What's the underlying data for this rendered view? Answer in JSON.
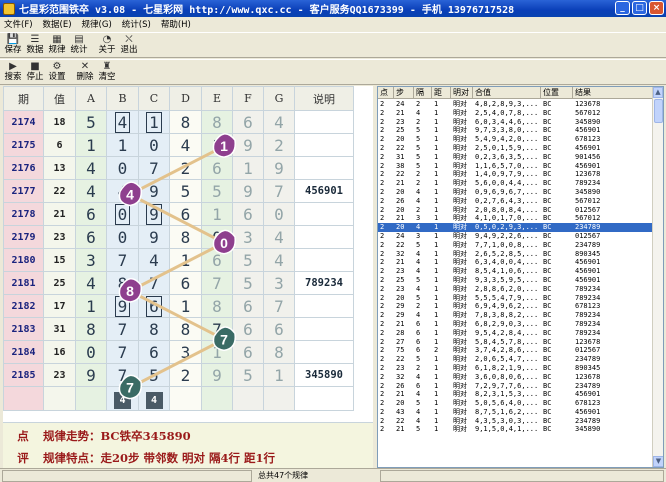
{
  "window": {
    "title": "七星彩范围铁卒 v3.08 - 七星彩网 http://www.qxc.cc - 客户服务QQ1673399 - 手机 13976717528"
  },
  "menu": [
    "文件(F)",
    "数据(E)",
    "规律(G)",
    "统计(S)",
    "帮助(H)"
  ],
  "toolbar1": [
    {
      "label": "保存",
      "icon": "save-icon",
      "glyph": "💾"
    },
    {
      "label": "数据",
      "icon": "data-icon",
      "glyph": "☰"
    },
    {
      "label": "规律",
      "icon": "rule-icon",
      "glyph": "▦"
    },
    {
      "label": "统计",
      "icon": "stats-icon",
      "glyph": "▤"
    },
    {
      "label": "关于",
      "icon": "about-icon",
      "glyph": "◔"
    },
    {
      "label": "退出",
      "icon": "exit-icon",
      "glyph": "⛌"
    }
  ],
  "toolbar2": [
    {
      "label": "搜索",
      "icon": "play-icon",
      "glyph": "▶"
    },
    {
      "label": "停止",
      "icon": "stop-icon",
      "glyph": "■"
    },
    {
      "label": "设置",
      "icon": "settings-icon",
      "glyph": "⚙"
    },
    {
      "label": "删除",
      "icon": "delete-icon",
      "glyph": "✕"
    },
    {
      "label": "清空",
      "icon": "clear-icon",
      "glyph": "♜"
    }
  ],
  "grid": {
    "headers": [
      "期",
      "值",
      "A",
      "B",
      "C",
      "D",
      "E",
      "F",
      "G",
      "说明"
    ],
    "rows": [
      {
        "qi": "2174",
        "zhi": "18",
        "digits": [
          "5",
          "4",
          "1",
          "8",
          "8",
          "6",
          "4"
        ],
        "note": ""
      },
      {
        "qi": "2175",
        "zhi": "6",
        "digits": [
          "1",
          "1",
          "0",
          "4",
          "1",
          "9",
          "2"
        ],
        "note": ""
      },
      {
        "qi": "2176",
        "zhi": "13",
        "digits": [
          "4",
          "0",
          "7",
          "2",
          "6",
          "1",
          "9"
        ],
        "note": ""
      },
      {
        "qi": "2177",
        "zhi": "22",
        "digits": [
          "4",
          "4",
          "9",
          "5",
          "5",
          "9",
          "7"
        ],
        "note": "456901"
      },
      {
        "qi": "2178",
        "zhi": "21",
        "digits": [
          "6",
          "0",
          "9",
          "6",
          "1",
          "6",
          "0"
        ],
        "note": ""
      },
      {
        "qi": "2179",
        "zhi": "23",
        "digits": [
          "6",
          "0",
          "9",
          "8",
          "0",
          "3",
          "4"
        ],
        "note": ""
      },
      {
        "qi": "2180",
        "zhi": "15",
        "digits": [
          "3",
          "7",
          "4",
          "1",
          "6",
          "5",
          "4"
        ],
        "note": ""
      },
      {
        "qi": "2181",
        "zhi": "25",
        "digits": [
          "4",
          "8",
          "7",
          "6",
          "7",
          "5",
          "3"
        ],
        "note": "789234"
      },
      {
        "qi": "2182",
        "zhi": "17",
        "digits": [
          "1",
          "9",
          "6",
          "1",
          "8",
          "6",
          "7"
        ],
        "note": ""
      },
      {
        "qi": "2183",
        "zhi": "31",
        "digits": [
          "8",
          "7",
          "8",
          "8",
          "7",
          "6",
          "6"
        ],
        "note": ""
      },
      {
        "qi": "2184",
        "zhi": "16",
        "digits": [
          "0",
          "7",
          "6",
          "3",
          "1",
          "6",
          "8"
        ],
        "note": ""
      },
      {
        "qi": "2185",
        "zhi": "23",
        "digits": [
          "9",
          "7",
          "5",
          "2",
          "9",
          "5",
          "1"
        ],
        "note": "345890"
      },
      {
        "qi": "",
        "zhi": "",
        "digits": [
          "",
          "4",
          "4",
          "",
          "",
          "",
          ""
        ],
        "note": ""
      }
    ]
  },
  "summary": {
    "k1": "点",
    "line1": "规律走势：BC铁卒345890",
    "k2": "评",
    "line2": "规律特点：走20步  带邻数  明对    隔4行  距1行"
  },
  "list": {
    "headers": [
      "点",
      "步",
      "隔",
      "距",
      "明对",
      "合值",
      "位置",
      "结果"
    ],
    "selected_index": 14,
    "rows": [
      [
        "2",
        "24",
        "2",
        "1",
        "明对",
        "4,8,2,8,9,3,...",
        "BC",
        "123678"
      ],
      [
        "2",
        "21",
        "4",
        "1",
        "明对",
        "2,5,4,0,7,8,...",
        "BC",
        "567012"
      ],
      [
        "2",
        "23",
        "2",
        "1",
        "明对",
        "6,0,3,4,4,6,...",
        "BC",
        "345890"
      ],
      [
        "2",
        "25",
        "5",
        "1",
        "明对",
        "9,7,3,3,8,0,...",
        "BC",
        "456901"
      ],
      [
        "2",
        "20",
        "5",
        "1",
        "明对",
        "5,4,9,4,2,0,...",
        "BC",
        "678123"
      ],
      [
        "2",
        "22",
        "5",
        "1",
        "明对",
        "2,5,0,1,5,9,...",
        "BC",
        "456901"
      ],
      [
        "2",
        "31",
        "5",
        "1",
        "明对",
        "0,2,3,6,3,5,...",
        "BC",
        "901456"
      ],
      [
        "2",
        "38",
        "5",
        "1",
        "明对",
        "1,1,6,5,7,0,...",
        "BC",
        "456901"
      ],
      [
        "2",
        "22",
        "2",
        "1",
        "明对",
        "1,4,0,9,7,9,...",
        "BC",
        "123678"
      ],
      [
        "2",
        "21",
        "2",
        "1",
        "明对",
        "5,6,0,0,4,4,...",
        "BC",
        "789234"
      ],
      [
        "2",
        "20",
        "4",
        "1",
        "明对",
        "0,9,6,9,6,7,...",
        "BC",
        "345890"
      ],
      [
        "2",
        "26",
        "4",
        "1",
        "明对",
        "0,2,7,6,4,3,...",
        "BC",
        "567012"
      ],
      [
        "2",
        "20",
        "2",
        "1",
        "明对",
        "2,0,8,0,8,4,...",
        "BC",
        "012567"
      ],
      [
        "2",
        "21",
        "3",
        "1",
        "明对",
        "4,1,0,1,7,0,...",
        "BC",
        "567012"
      ],
      [
        "2",
        "20",
        "4",
        "1",
        "明对",
        "0,5,0,2,9,3,...",
        "BC",
        "234789"
      ],
      [
        "2",
        "24",
        "3",
        "1",
        "明对",
        "9,4,9,2,2,6,...",
        "BC",
        "012567"
      ],
      [
        "2",
        "22",
        "5",
        "1",
        "明对",
        "7,7,1,0,0,8,...",
        "BC",
        "234789"
      ],
      [
        "2",
        "32",
        "4",
        "1",
        "明对",
        "2,6,5,2,8,5,...",
        "BC",
        "890345"
      ],
      [
        "2",
        "21",
        "4",
        "1",
        "明对",
        "6,3,4,0,0,4,...",
        "BC",
        "456901"
      ],
      [
        "2",
        "23",
        "4",
        "1",
        "明对",
        "8,5,4,1,0,6,...",
        "BC",
        "456901"
      ],
      [
        "2",
        "25",
        "5",
        "1",
        "明对",
        "9,3,3,5,9,5,...",
        "BC",
        "456901"
      ],
      [
        "2",
        "23",
        "4",
        "1",
        "明对",
        "2,8,8,6,2,0,...",
        "BC",
        "789234"
      ],
      [
        "2",
        "20",
        "5",
        "1",
        "明对",
        "5,5,5,4,7,9,...",
        "BC",
        "789234"
      ],
      [
        "2",
        "29",
        "2",
        "1",
        "明对",
        "6,9,4,9,6,2,...",
        "BC",
        "678123"
      ],
      [
        "2",
        "29",
        "4",
        "1",
        "明对",
        "7,8,3,8,8,2,...",
        "BC",
        "789234"
      ],
      [
        "2",
        "21",
        "6",
        "1",
        "明对",
        "6,8,2,9,0,3,...",
        "BC",
        "789234"
      ],
      [
        "2",
        "28",
        "6",
        "1",
        "明对",
        "9,5,4,2,8,4,...",
        "BC",
        "789234"
      ],
      [
        "2",
        "27",
        "6",
        "1",
        "明对",
        "5,8,4,5,7,8,...",
        "BC",
        "123678"
      ],
      [
        "2",
        "75",
        "6",
        "2",
        "明对",
        "3,7,4,2,8,6,...",
        "BC",
        "012567"
      ],
      [
        "2",
        "22",
        "5",
        "1",
        "明对",
        "2,0,6,5,4,7,...",
        "BC",
        "234789"
      ],
      [
        "2",
        "23",
        "2",
        "1",
        "明对",
        "6,1,8,2,1,9,...",
        "BC",
        "890345"
      ],
      [
        "2",
        "32",
        "4",
        "1",
        "明对",
        "3,6,0,8,0,6,...",
        "BC",
        "123678"
      ],
      [
        "2",
        "26",
        "6",
        "1",
        "明对",
        "7,2,9,7,7,6,...",
        "BC",
        "234789"
      ],
      [
        "2",
        "21",
        "4",
        "1",
        "明对",
        "8,2,3,1,5,3,...",
        "BC",
        "456901"
      ],
      [
        "2",
        "20",
        "5",
        "1",
        "明对",
        "5,0,5,6,4,0,...",
        "BC",
        "678123"
      ],
      [
        "2",
        "43",
        "4",
        "1",
        "明对",
        "8,7,5,1,6,2,...",
        "BC",
        "456901"
      ],
      [
        "2",
        "22",
        "4",
        "1",
        "明对",
        "4,3,5,3,0,3,...",
        "BC",
        "234789"
      ],
      [
        "2",
        "21",
        "5",
        "1",
        "明对",
        "9,1,5,0,4,1,...",
        "BC",
        "345890"
      ]
    ]
  },
  "status": {
    "text": "总共47个规律"
  },
  "colors": {
    "ball_purple": "#8e3f8e",
    "ball_teal": "#3a6b65",
    "line": "#e3c28c"
  }
}
